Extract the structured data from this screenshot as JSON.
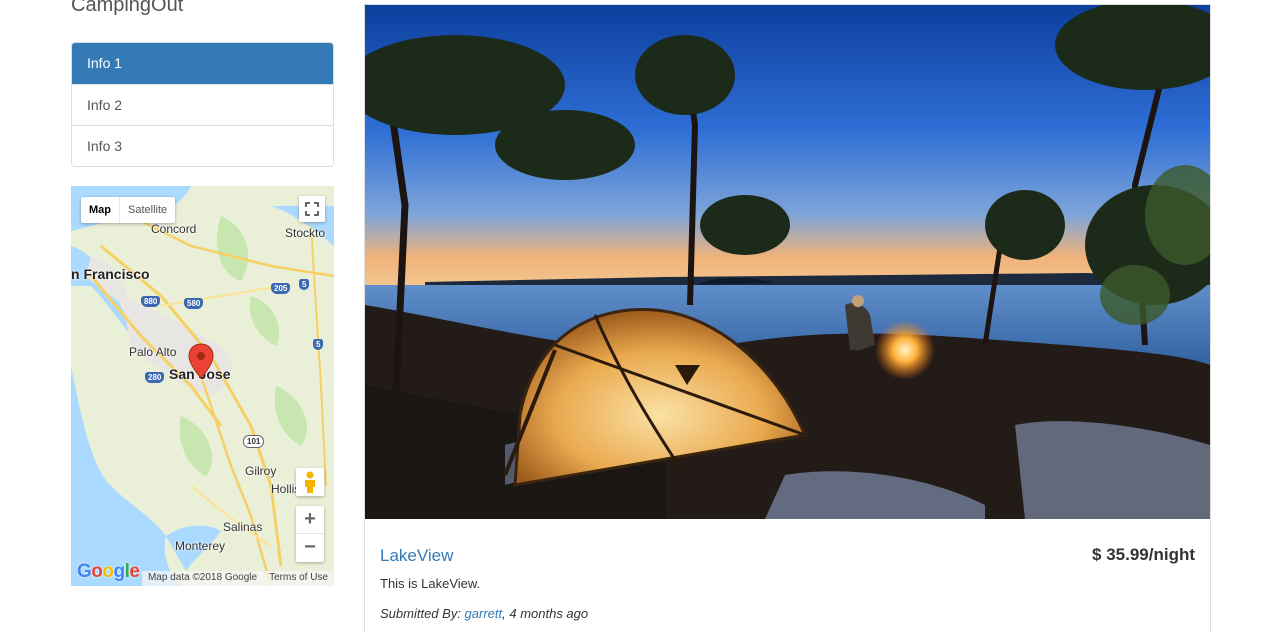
{
  "brand": "CampingOut",
  "sidebar": {
    "items": [
      {
        "label": "Info 1",
        "active": true
      },
      {
        "label": "Info 2",
        "active": false
      },
      {
        "label": "Info 3",
        "active": false
      }
    ]
  },
  "map": {
    "type_options": [
      "Map",
      "Satellite"
    ],
    "selected_type": "Map",
    "labels": {
      "concord": "Concord",
      "stockton": "Stockto",
      "sf": "n Francisco",
      "palo_alto": "Palo Alto",
      "san_jose": "San Jose",
      "gilroy": "Gilroy",
      "hollister": "Hollis",
      "salinas": "Salinas",
      "monterey": "Monterey"
    },
    "shields": [
      "880",
      "580",
      "205",
      "5",
      "5",
      "280",
      "101"
    ],
    "logo": "Google",
    "attribution": "Map data ©2018 Google",
    "terms": "Terms of Use",
    "zoom_in": "+",
    "zoom_out": "−",
    "colors": {
      "water": "#aadaff",
      "land": "#eaf0d8",
      "park": "#c8e6b0",
      "urban": "#e8e8e8",
      "road": "#f6cf65"
    }
  },
  "listing": {
    "title": "LakeView",
    "price": "$ 35.99/night",
    "description": "This is LakeView.",
    "submitted_prefix": "Submitted By: ",
    "author": "garrett",
    "time_suffix": ", 4 months ago"
  },
  "colors": {
    "accent": "#337ab7"
  }
}
